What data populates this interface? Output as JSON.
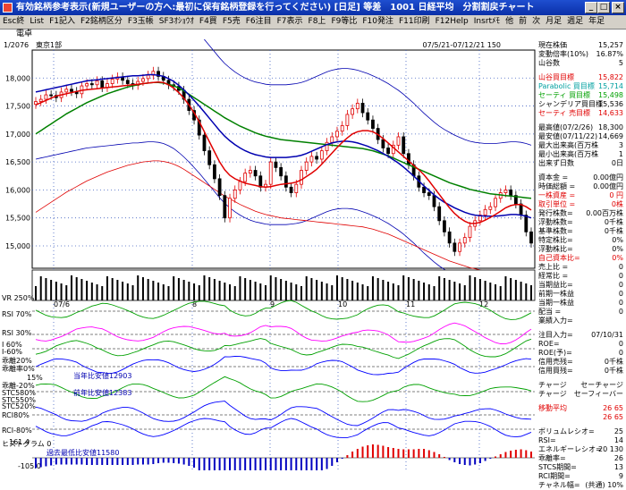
{
  "window": {
    "title": "有効銘柄参考表示(新規ユーザーの方へ:最初に保有銘柄登録を行ってください) [日足] 等差　1001 日経平均　分割割戻チャート",
    "buttons": [
      "_",
      "□",
      "×"
    ]
  },
  "menu": [
    "Esc終",
    "List",
    "F1記入",
    "F2銘柄区分",
    "F3玉帳",
    "SF3ｵｼｮｳｵ",
    "F4買",
    "F5売",
    "F6注目",
    "F7表示",
    "F8上",
    "F9等比",
    "F10発注",
    "F11印刷",
    "F12Help",
    "Insrtﾒﾓ",
    "他",
    "前",
    "次",
    "月足",
    "週足",
    "年足"
  ],
  "header": {
    "tag": "電卓",
    "code": "1/2076",
    "market": "東京1部",
    "range": "07/5/21-07/12/21 150"
  },
  "colors": {
    "candle_up": "#e00000",
    "candle_down": "#000000",
    "ma_short": "#e00000",
    "ma_mid": "#0000b0",
    "ma_long": "#008000",
    "band": "#e00000",
    "band2": "#0000b0",
    "ma_xlong": "#c000c0",
    "rsi": "#00a000",
    "macd": "#0000ff"
  },
  "chart_data": {
    "type": "candlestick",
    "y_ticks": [
      "18,000",
      "17,500",
      "17,000",
      "16,500",
      "16,000",
      "15,500",
      "15,000"
    ],
    "ylim": [
      14600,
      18500
    ],
    "x_ticks": [
      "07/6",
      "8",
      "9",
      "10",
      "11",
      "12"
    ],
    "closes": [
      17580,
      17620,
      17700,
      17690,
      17650,
      17750,
      17800,
      17760,
      17720,
      17860,
      17900,
      17880,
      17950,
      17830,
      17900,
      17980,
      18020,
      17960,
      17900,
      17870,
      17940,
      17990,
      18050,
      18120,
      18030,
      17960,
      17880,
      17850,
      17780,
      17620,
      17420,
      17250,
      16980,
      16700,
      16450,
      16200,
      15900,
      15500,
      15850,
      16000,
      16150,
      16300,
      16350,
      16250,
      16050,
      16100,
      16500,
      16400,
      16250,
      16050,
      15950,
      16100,
      16350,
      16500,
      16600,
      16550,
      16700,
      16850,
      16950,
      17050,
      17150,
      17350,
      17450,
      17550,
      17380,
      17250,
      17100,
      16900,
      16750,
      16650,
      16800,
      16950,
      16650,
      16450,
      16250,
      16050,
      15950,
      15900,
      15700,
      15450,
      15250,
      15050,
      14900,
      15050,
      15150,
      15350,
      15450,
      15550,
      15650,
      15700,
      15850,
      15950,
      16000,
      15900,
      15750,
      15550,
      15250,
      15050
    ],
    "ma_short": [
      17520,
      17560,
      17600,
      17640,
      17680,
      17700,
      17720,
      17740,
      17760,
      17780,
      17790,
      17800,
      17810,
      17820,
      17830,
      17840,
      17850,
      17860,
      17870,
      17880,
      17890,
      17900,
      17910,
      17920,
      17930,
      17920,
      17880,
      17820,
      17740,
      17640,
      17520,
      17380,
      17220,
      17040,
      16860,
      16680,
      16500,
      16360,
      16260,
      16200,
      16160,
      16120,
      16100,
      16080,
      16060,
      16050,
      16060,
      16080,
      16100,
      16110,
      16120,
      16140,
      16180,
      16240,
      16300,
      16370,
      16460,
      16560,
      16660,
      16760,
      16850,
      16930,
      17000,
      17040,
      17060,
      17060,
      17040,
      16990,
      16920,
      16840,
      16760,
      16680,
      16600,
      16520,
      16440,
      16360,
      16270,
      16160,
      16040,
      15920,
      15800,
      15680,
      15580,
      15500,
      15440,
      15400,
      15400,
      15420,
      15460,
      15510,
      15560,
      15620,
      15680,
      15720,
      15740,
      15740,
      15700,
      15640
    ],
    "ma_mid": [
      17750,
      17770,
      17790,
      17810,
      17830,
      17850,
      17870,
      17890,
      17910,
      17930,
      17950,
      17960,
      17970,
      17980,
      17990,
      18000,
      18010,
      18020,
      18030,
      18040,
      18040,
      18050,
      18060,
      18060,
      18050,
      18030,
      17990,
      17940,
      17870,
      17790,
      17700,
      17600,
      17500,
      17390,
      17280,
      17170,
      17060,
      16960,
      16880,
      16810,
      16750,
      16700,
      16660,
      16630,
      16610,
      16590,
      16580,
      16580,
      16580,
      16580,
      16590,
      16600,
      16620,
      16650,
      16690,
      16730,
      16770,
      16810,
      16840,
      16860,
      16870,
      16870,
      16860,
      16840,
      16810,
      16780,
      16740,
      16700,
      16650,
      16600,
      16540,
      16480,
      16410,
      16330,
      16250,
      16160,
      16070,
      15990,
      15910,
      15840,
      15780,
      15730,
      15680,
      15640,
      15600,
      15570,
      15550,
      15540,
      15530,
      15530,
      15530,
      15540,
      15550,
      15560,
      15560,
      15550,
      15530,
      15500
    ],
    "ma_long": [
      17000,
      17060,
      17120,
      17180,
      17240,
      17300,
      17360,
      17410,
      17460,
      17510,
      17560,
      17600,
      17640,
      17680,
      17720,
      17750,
      17780,
      17810,
      17840,
      17860,
      17880,
      17900,
      17910,
      17920,
      17920,
      17910,
      17890,
      17860,
      17820,
      17770,
      17710,
      17650,
      17590,
      17530,
      17470,
      17410,
      17350,
      17290,
      17240,
      17190,
      17140,
      17100,
      17060,
      17020,
      16990,
      16960,
      16940,
      16920,
      16900,
      16890,
      16880,
      16870,
      16860,
      16850,
      16840,
      16830,
      16820,
      16810,
      16800,
      16790,
      16780,
      16770,
      16760,
      16750,
      16740,
      16720,
      16700,
      16670,
      16640,
      16610,
      16570,
      16530,
      16490,
      16450,
      16410,
      16370,
      16330,
      16290,
      16250,
      16210,
      16170,
      16130,
      16100,
      16070,
      16040,
      16010,
      15990,
      15970,
      15950,
      15930,
      15920,
      15910,
      15900,
      15890,
      15880,
      15870,
      15860,
      15850
    ],
    "volume_label": "VR 250%",
    "indicators": [
      "RSI 70%",
      "RSI 30%",
      "I 60%",
      "I-60%",
      "乖離20%",
      "乖離率0%",
      "乖離-20%",
      "STC580%",
      "STC550%",
      "STC520%",
      "RCI80%",
      "RCI-80%",
      "ヒストグラム 0"
    ],
    "annotations": [
      "当年比安値12903",
      "前年比安値12383",
      "過去最低比安値11580"
    ],
    "axis_marks": [
      "15%",
      "161.4",
      "-105.0"
    ]
  },
  "panel": [
    [
      "現在株価",
      "15,257"
    ],
    [
      "変動倍率(10%)",
      "16.87%"
    ],
    [
      "山谷数",
      "5"
    ],
    [
      "山谷買目標",
      "15,822"
    ],
    [
      "Parabolic 買目標",
      "15,714"
    ],
    [
      "セーティ 買目標",
      "15,498"
    ],
    [
      "シャンデリア買目標",
      "15,536"
    ],
    [
      "セーティ 売目標",
      "14,633"
    ],
    [
      "最高値(07/2/26)",
      "18,300"
    ],
    [
      "最安値(07/11/22)",
      "14,669"
    ],
    [
      "最大出来高(百万株",
      "3"
    ],
    [
      "最小出来高(百万株",
      "1"
    ],
    [
      "出来ず日数",
      "0日"
    ],
    [
      "資本金 =",
      "0.00億円"
    ],
    [
      "時価総額 =",
      "0.00億円"
    ],
    [
      "一株資産 =",
      "0 円"
    ],
    [
      "取引単位 =",
      "0株"
    ],
    [
      "発行株数=",
      "0.00百万株"
    ],
    [
      "浮動株数=",
      "0千株"
    ],
    [
      "基準株数=",
      "0千株"
    ],
    [
      "特定株比=",
      "0%"
    ],
    [
      "浮動株比=",
      "0%"
    ],
    [
      "自己資本比=",
      "0%"
    ],
    [
      "売上比 =",
      "0"
    ],
    [
      "経常比 =",
      "0"
    ],
    [
      "当期益比=",
      "0"
    ],
    [
      "前期一株益",
      "0"
    ],
    [
      "当期一株益",
      "0"
    ],
    [
      "配当 =",
      "0"
    ],
    [
      "業績入力=",
      ""
    ],
    [
      "注目入力=",
      "07/10/31"
    ],
    [
      "ROE=",
      "0"
    ],
    [
      "ROE(予)=",
      "0"
    ],
    [
      "信用売残=",
      "0千株"
    ],
    [
      "信用買残=",
      "0千株"
    ],
    [
      "チャージ",
      "セーチャージ"
    ],
    [
      "チャージ",
      "セーフィーバー"
    ],
    [
      "移動平均",
      "26 65"
    ],
    [
      "",
      "26 65"
    ],
    [
      "ボリュムレシオ=",
      "25"
    ],
    [
      "RSI=",
      "14"
    ],
    [
      "エネルギーレシオ=",
      "20 130"
    ],
    [
      "乖離率=",
      "26"
    ],
    [
      "STCS期間=",
      "13"
    ],
    [
      "RCI期間=",
      "9"
    ],
    [
      "チャネル幅=",
      "(共通) 10%"
    ]
  ]
}
